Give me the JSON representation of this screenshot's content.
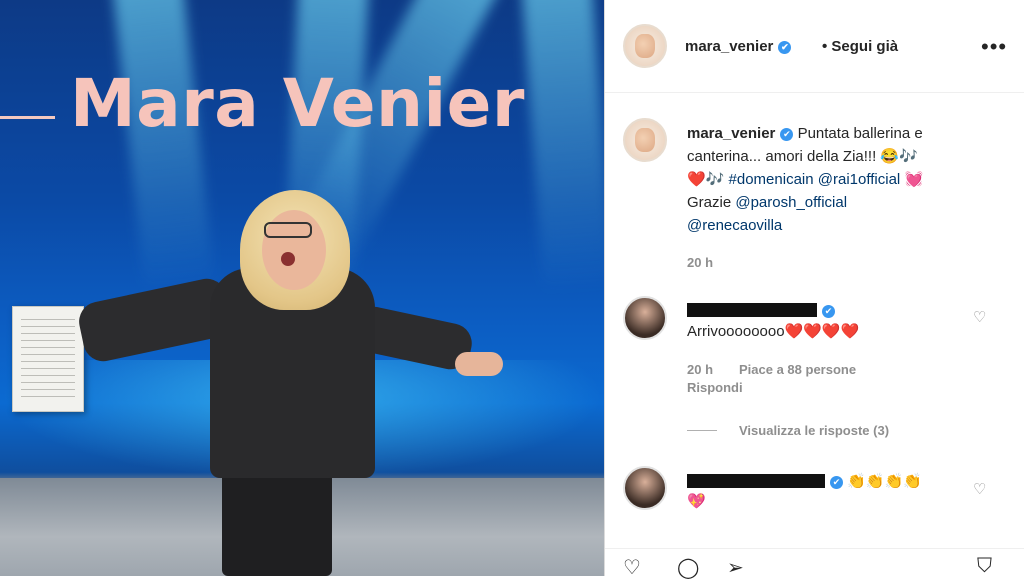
{
  "photo": {
    "logo_text": "Mara Venier"
  },
  "header": {
    "username": "mara_venier",
    "verified": "✔",
    "follow_text": "• Segui già",
    "more_icon": "more-icon"
  },
  "caption": {
    "username": "mara_venier",
    "text_part1": "Puntata ballerina e canterina... amori della Zia!!! 😂🎶",
    "text_part2": "❤️🎶",
    "hashtag": "#domenicain",
    "mention1": "@rai1official",
    "text_part3": "💓",
    "text_part4": "Grazie",
    "mention2": "@parosh_official",
    "mention3": "@renecaovilla",
    "time": "20 h"
  },
  "comments": [
    {
      "text": "Arrivoooooooo❤️❤️❤️❤️",
      "time": "20 h",
      "likes": "Piace a 88 persone",
      "reply": "Rispondi",
      "view_replies": "Visualizza le risposte (3)"
    },
    {
      "text_inline": "👏👏👏👏",
      "text": "💖"
    }
  ],
  "colors": {
    "link": "#00376b",
    "verified": "#3897f0",
    "meta": "#8e8e8e",
    "logo": "#f6c4bb"
  }
}
